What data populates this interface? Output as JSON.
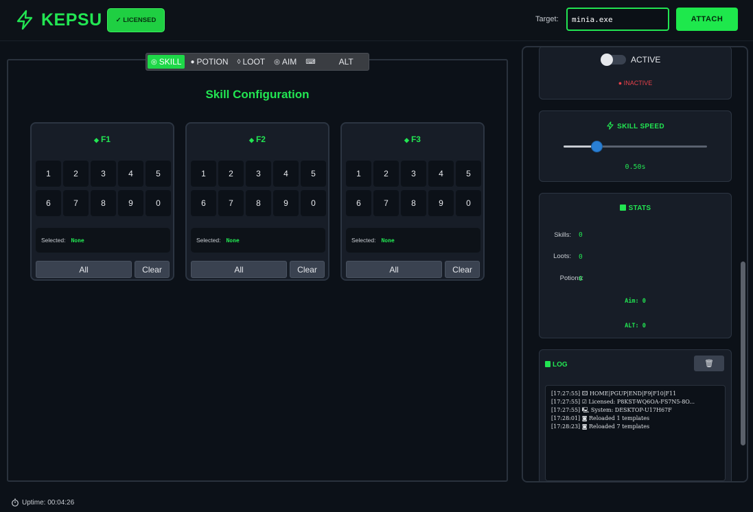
{
  "header": {
    "app_name": "KEPSU",
    "license_badge": "✓ LICENSED",
    "target_label": "Target:",
    "target_value": "minia.exe",
    "attach_label": "ATTACH"
  },
  "tabs": [
    {
      "icon": "◎",
      "label": "SKILL",
      "active": true
    },
    {
      "icon": "●",
      "label": "POTION"
    },
    {
      "icon": "◊",
      "label": "LOOT"
    },
    {
      "icon": "◎",
      "label": "AIM"
    },
    {
      "icon": "⌨",
      "label": ""
    },
    {
      "icon": "",
      "label": "ALT"
    }
  ],
  "skill_config": {
    "title": "Skill Configuration",
    "cards": [
      {
        "name": "F1",
        "selected_label": "Selected:",
        "selected_value": "None",
        "all_label": "All",
        "clear_label": "Clear"
      },
      {
        "name": "F2",
        "selected_label": "Selected:",
        "selected_value": "None",
        "all_label": "All",
        "clear_label": "Clear"
      },
      {
        "name": "F3",
        "selected_label": "Selected:",
        "selected_value": "None",
        "all_label": "All",
        "clear_label": "Clear"
      }
    ],
    "keys": [
      "1",
      "2",
      "3",
      "4",
      "5",
      "6",
      "7",
      "8",
      "9",
      "0"
    ]
  },
  "sidebar": {
    "toggle_label": "ACTIVE",
    "toggle_on": false,
    "status": "● INACTIVE",
    "skill_speed": {
      "heading": "SKILL SPEED",
      "value_display": "0.50s",
      "level": 0.23
    },
    "stats": {
      "heading": "STATS",
      "skills_label": "Skills:",
      "skills_value": "0",
      "loots_label": "Loots:",
      "loots_value": "0",
      "potions_label": "Potions:",
      "potions_value": "0",
      "aim_line": "Aim: 0",
      "alt_line": "ALT: 0"
    },
    "log": {
      "heading": "LOG",
      "clear_icon": "🗑",
      "lines": [
        "[17:27:55] 🖾   HOME|PGUP|END|F9|F10|F11",
        "[17:27:55] ☑ Licensed: P8KST-WQ6OA-FS7N5-8O...",
        "[17:27:55] 🖳    System: DESKTOP-U17H67F",
        "[17:28:01] ◙ Reloaded 1 templates",
        "[17:28:23] ◙ Reloaded 7 templates"
      ]
    }
  },
  "footer": {
    "uptime": "Uptime: 00:04:26"
  },
  "colors": {
    "accent": "#22e552",
    "background": "#0c1118",
    "card": "#171d27",
    "inactive": "#e8414a",
    "slider_thumb": "#2a7fd4"
  }
}
